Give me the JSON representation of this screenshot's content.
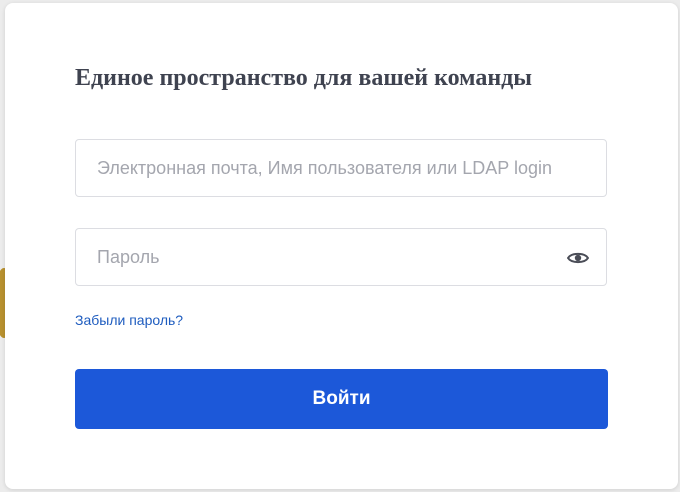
{
  "colors": {
    "page_background": "#ececec",
    "card_background": "#ffffff",
    "title_text": "#3f4350",
    "input_border": "#dcdde2",
    "placeholder_text": "#a4a6ae",
    "link": "#1e5cbf",
    "primary_button": "#1c58d9",
    "primary_button_text": "#ffffff",
    "decor_accent": "#b8912f"
  },
  "login_form": {
    "title": "Единое пространство для вашей команды",
    "login_field": {
      "value": "",
      "placeholder": "Электронная почта, Имя пользователя или LDAP login"
    },
    "password_field": {
      "value": "",
      "placeholder": "Пароль",
      "toggle_icon": "eye-icon"
    },
    "forgot_password_link": "Забыли пароль?",
    "submit_label": "Войти"
  }
}
